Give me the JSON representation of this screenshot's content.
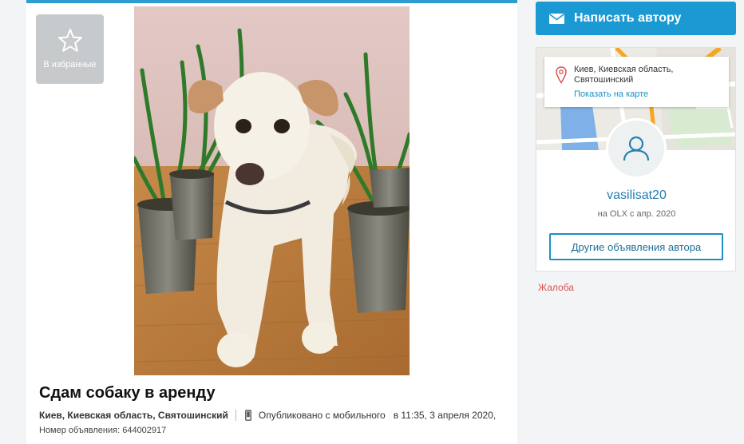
{
  "favorite": {
    "label": "В избранные",
    "icon": "star-icon"
  },
  "ad": {
    "title": "Сдам собаку в аренду",
    "location": "Киев, Киевская область, Святошинский",
    "published_via": "Опубликовано с мобильного",
    "published_at": "в 11:35, 3 апреля 2020,",
    "ad_number": "Номер объявления: 644002917"
  },
  "contact": {
    "label": "Написать автору",
    "icon": "envelope-icon"
  },
  "seller": {
    "location": "Киев, Киевская область, Святошинский",
    "map_link": "Показать на карте",
    "username": "vasilisat20",
    "member_since": "на OLX с апр. 2020",
    "other_ads": "Другие объявления автора"
  },
  "complaint": "Жалоба",
  "colors": {
    "accent": "#1b99d3",
    "top_border": "#2e9cd0",
    "complaint": "#d9534f"
  }
}
